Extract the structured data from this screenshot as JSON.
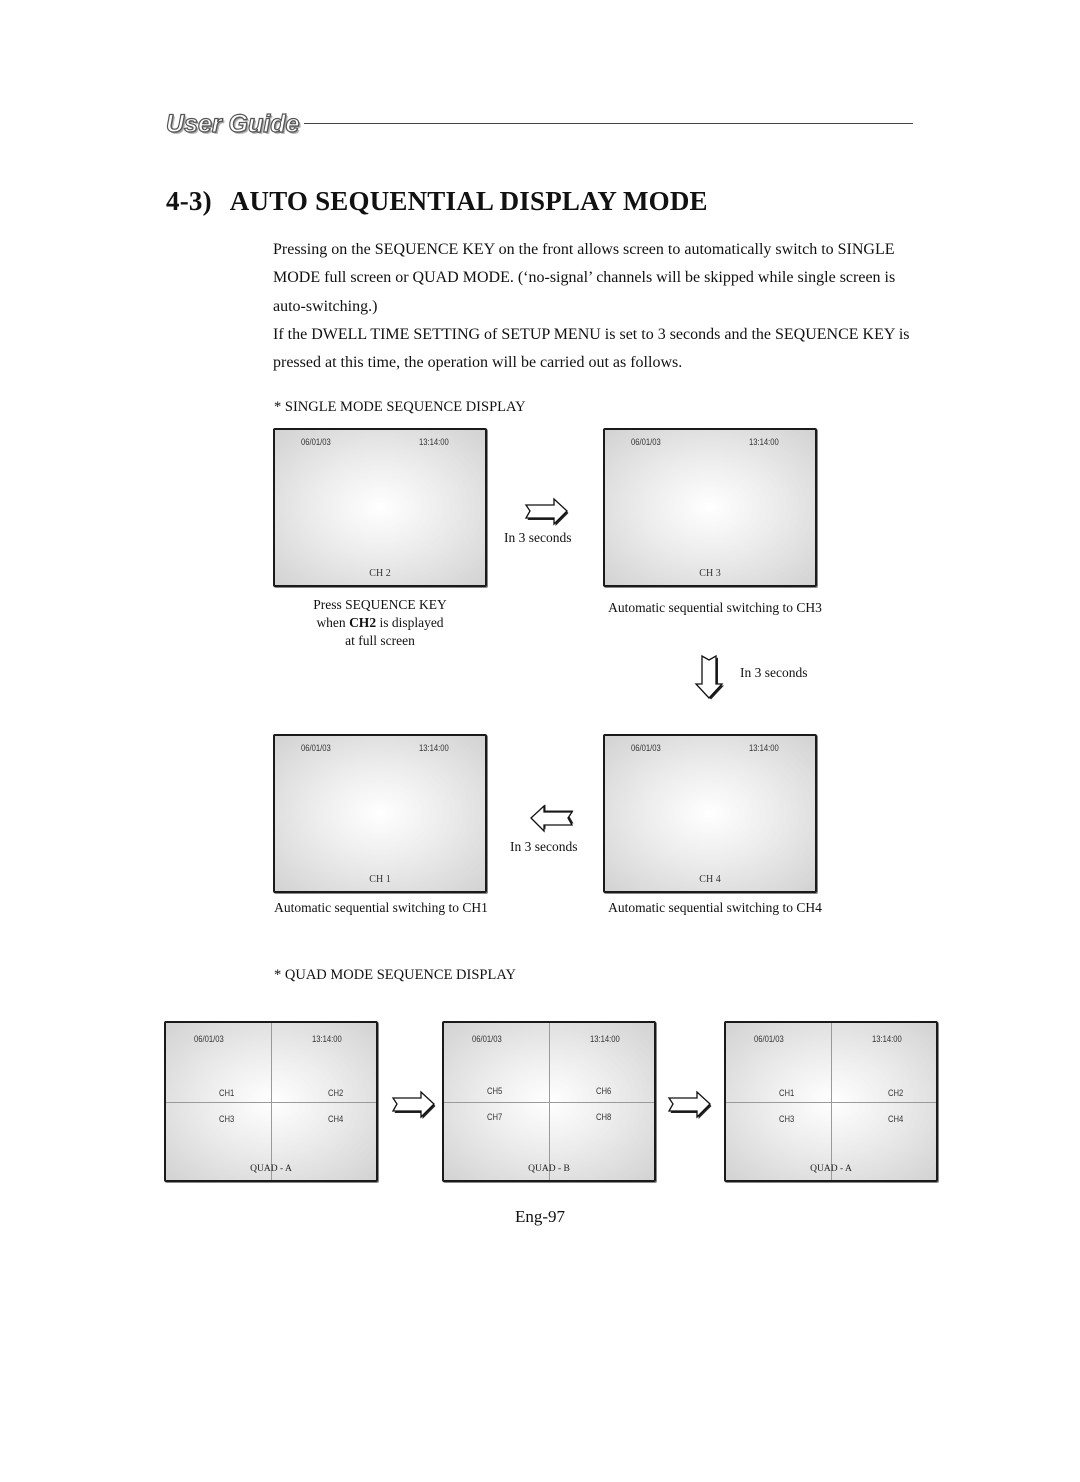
{
  "header": {
    "logo_text": "User Guide"
  },
  "section": {
    "number": "4-3)",
    "title": "AUTO SEQUENTIAL DISPLAY MODE"
  },
  "paragraphs": [
    "Pressing on the SEQUENCE KEY on the front allows screen to automatically switch to SINGLE MODE full screen or QUAD MODE. (‘no-signal’ channels will be skipped while single screen is auto-switching.)",
    "If the DWELL TIME SETTING of SETUP MENU is set to 3 seconds and the SEQUENCE KEY is pressed at this time, the operation will be carried out as follows."
  ],
  "single_mode": {
    "heading": "* SINGLE MODE SEQUENCE DISPLAY",
    "screens": [
      {
        "date": "06/01/03",
        "time": "13:14:00",
        "channel": "CH 2"
      },
      {
        "date": "06/01/03",
        "time": "13:14:00",
        "channel": "CH 3"
      },
      {
        "date": "06/01/03",
        "time": "13:14:00",
        "channel": "CH 1"
      },
      {
        "date": "06/01/03",
        "time": "13:14:00",
        "channel": "CH 4"
      }
    ],
    "captions": {
      "ch2_line1": "Press SEQUENCE KEY",
      "ch2_line2_pre": "when ",
      "ch2_line2_bold": "CH2",
      "ch2_line2_post": " is displayed",
      "ch2_line3": "at full screen",
      "ch3": "Automatic sequential switching to CH3",
      "ch1": "Automatic sequential switching to CH1",
      "ch4": "Automatic sequential switching to CH4"
    },
    "interval_labels": [
      "In 3 seconds",
      "In 3 seconds",
      "In 3 seconds"
    ]
  },
  "quad_mode": {
    "heading": "* QUAD MODE SEQUENCE DISPLAY",
    "screens": [
      {
        "date": "06/01/03",
        "time": "13:14:00",
        "channels": [
          "CH1",
          "CH2",
          "CH3",
          "CH4"
        ],
        "label": "QUAD - A"
      },
      {
        "date": "06/01/03",
        "time": "13:14:00",
        "channels": [
          "CH5",
          "CH6",
          "CH7",
          "CH8"
        ],
        "label": "QUAD - B"
      },
      {
        "date": "06/01/03",
        "time": "13:14:00",
        "channels": [
          "CH1",
          "CH2",
          "CH3",
          "CH4"
        ],
        "label": "QUAD - A"
      }
    ]
  },
  "footer": {
    "page_number": "Eng-97"
  }
}
